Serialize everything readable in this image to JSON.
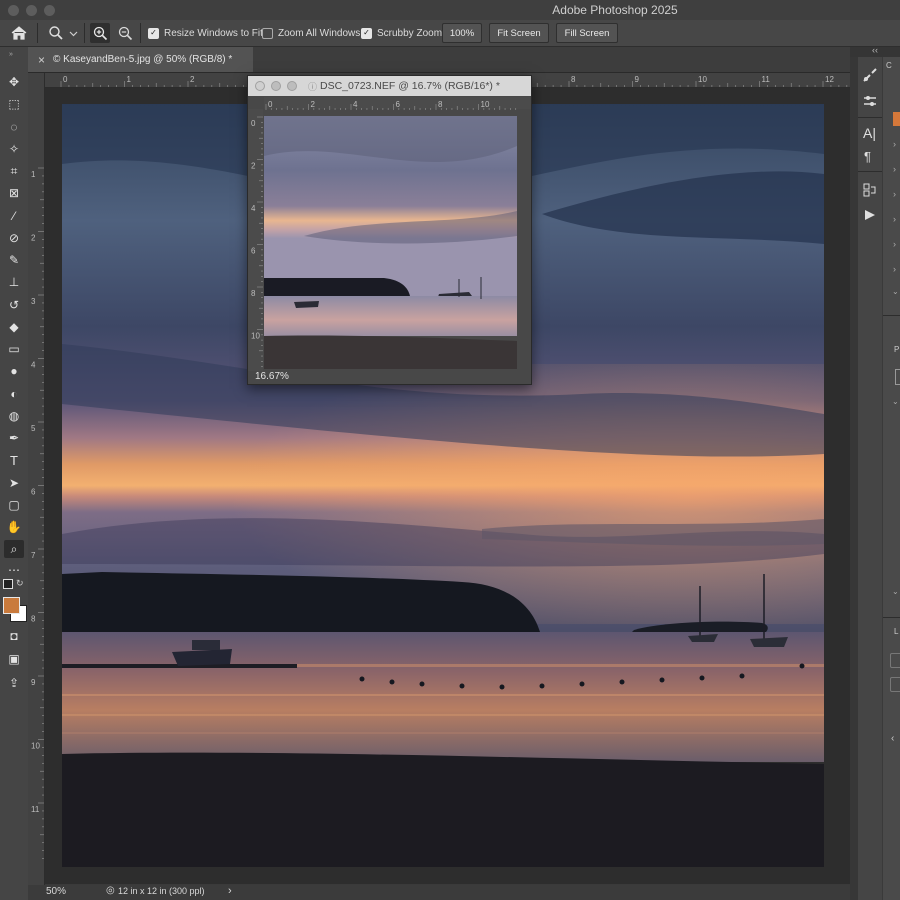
{
  "app": {
    "title": "Adobe Photoshop 2025"
  },
  "options_bar": {
    "tool_icon": "zoom-icon",
    "resize_windows_to_fit": {
      "label": "Resize Windows to Fit",
      "checked": true
    },
    "zoom_all_windows": {
      "label": "Zoom All Windows",
      "checked": false
    },
    "scrubby_zoom": {
      "label": "Scrubby Zoom",
      "checked": true
    },
    "zoom_100_label": "100%",
    "fit_screen_label": "Fit Screen",
    "fill_screen_label": "Fill Screen"
  },
  "document_tab": {
    "close_glyph": "×",
    "title": "© KaseyandBen-5.jpg @ 50% (RGB/8) *"
  },
  "rulers": {
    "horizontal_ticks": [
      "0",
      "1",
      "2",
      "3",
      "4",
      "5",
      "6",
      "7",
      "8",
      "9",
      "10",
      "11",
      "12"
    ],
    "vertical_ticks": [
      "1",
      "2",
      "3",
      "4",
      "5",
      "6",
      "7",
      "8",
      "9",
      "1 0",
      "1 1"
    ]
  },
  "status_bar": {
    "zoom": "50%",
    "doc_info": "12 in x 12 in (300 ppl)",
    "arrow": "›"
  },
  "floating_window": {
    "title": "DSC_0723.NEF @ 16.7% (RGB/16*) *",
    "zoom": "16.67%",
    "hruler_ticks": [
      "0",
      "2",
      "4",
      "6",
      "8",
      "10"
    ],
    "vruler_ticks": [
      "0",
      "2",
      "4",
      "6",
      "8",
      "1 0"
    ]
  },
  "colors": {
    "foreground": "#c97a3c",
    "background": "#ffffff",
    "panel_accent": "#d5783a"
  },
  "tools": [
    "move-icon",
    "marquee-icon",
    "lasso-icon",
    "magic-wand-icon",
    "crop-icon",
    "frame-icon",
    "eyedropper-icon",
    "healing-brush-icon",
    "brush-icon",
    "clone-stamp-icon",
    "history-brush-icon",
    "eraser-icon",
    "gradient-icon",
    "blur-icon",
    "dodge-icon",
    "sponge-icon",
    "pen-icon",
    "type-icon",
    "path-selection-icon",
    "rectangle-icon",
    "hand-icon",
    "zoom-icon",
    "more-tools-icon",
    "swap-colors-icon",
    "quick-mask-icon",
    "screen-mode-icon",
    "share-icon"
  ],
  "right_panel": {
    "icons": [
      "brush-settings-icon",
      "adjustments-icon",
      "character-icon",
      "paragraph-icon",
      "actions-icon",
      "play-icon"
    ],
    "tab_letters": [
      "C",
      "P",
      "L"
    ]
  }
}
